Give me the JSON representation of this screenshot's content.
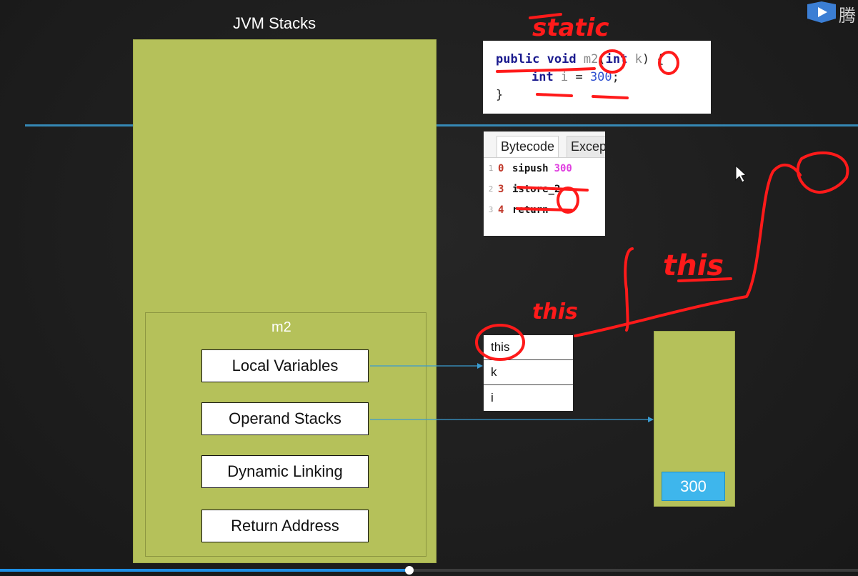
{
  "stack": {
    "title": "JVM Stacks",
    "frame_name": "m2",
    "slots": [
      "Local Variables",
      "Operand Stacks",
      "Dynamic Linking",
      "Return Address"
    ]
  },
  "code": {
    "kw_public": "public",
    "kw_void": "void",
    "method": "m2",
    "open_paren": "(",
    "kw_int": "int",
    "param": "k",
    "close": ") {",
    "indent_kw": "int",
    "var": "i",
    "assign": " = ",
    "value": "300",
    "semicolon": ";",
    "close_brace": "}"
  },
  "bytecode": {
    "tab_active": "Bytecode",
    "tab_inactive": "Excep",
    "rows": [
      {
        "line": "1",
        "offset": "0",
        "op": "sipush",
        "arg": "300"
      },
      {
        "line": "2",
        "offset": "3",
        "op": "istore_2",
        "arg": ""
      },
      {
        "line": "3",
        "offset": "4",
        "op": "return",
        "arg": ""
      }
    ]
  },
  "local_vars": [
    "this",
    "k",
    "i"
  ],
  "operand_stack": {
    "top_value": "300"
  },
  "annotations": {
    "static": "static",
    "this_small": "this",
    "this_large": "this"
  },
  "video": {
    "progress_fraction": 0.477
  },
  "colors": {
    "stack_green": "#b5c15a",
    "accent_blue": "#3eb6ec",
    "ink_red": "#ff0000",
    "divider_blue": "#3a9bd0"
  },
  "corner": {
    "icon": "play-icon",
    "text": "腾"
  }
}
